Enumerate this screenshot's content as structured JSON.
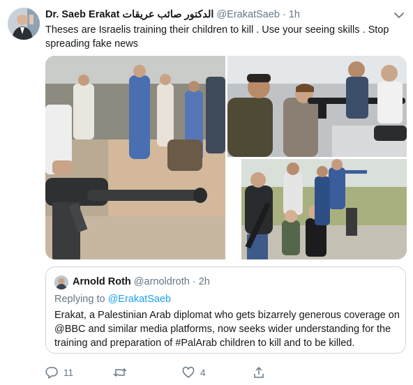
{
  "author": {
    "name": "Dr. Saeb Erakat",
    "name_arabic": "الدكتور صائب عريقات",
    "handle": "@ErakatSaeb",
    "separator": "·",
    "time": "1h"
  },
  "tweet_text": "Theses are Israelis training their children to kill . Use your seeing skills . Stop spreading fake news",
  "quoted": {
    "name": "Arnold Roth",
    "handle": "@arnoldroth",
    "separator": "·",
    "time": "2h",
    "replying_prefix": "Replying to ",
    "replying_to": "@ErakatSaeb",
    "text": "Erakat, a Palestinian Arab diplomat who gets bizarrely generous coverage on @BBC and similar media platforms, now seeks wider understanding for the training and preparation of #PalArab children to kill and to be killed."
  },
  "actions": {
    "reply_count": "11",
    "retweet_count": "",
    "like_count": "4"
  },
  "colors": {
    "text": "#14171a",
    "secondary": "#657786",
    "link": "#1da1f2",
    "border": "#ccd6dd"
  },
  "icons": {
    "caret": "chevron-down-icon",
    "reply": "reply-icon",
    "retweet": "retweet-icon",
    "like": "heart-icon",
    "share": "share-icon"
  }
}
